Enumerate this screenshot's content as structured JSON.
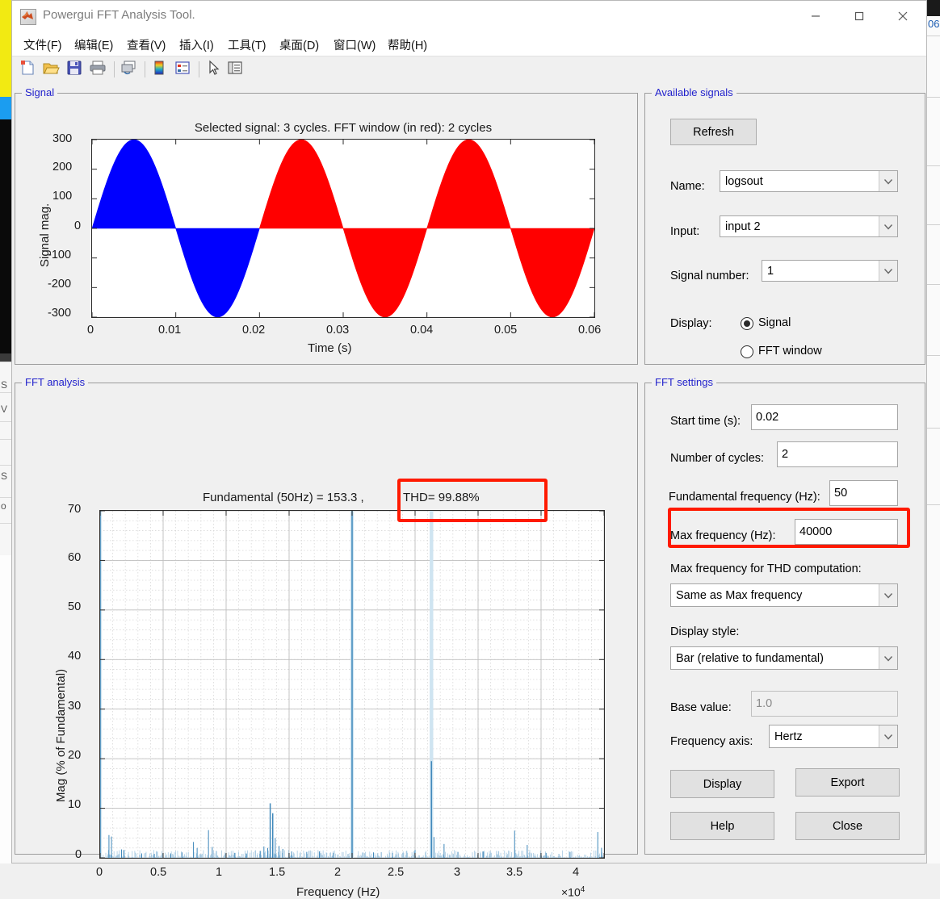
{
  "window": {
    "title": "Powergui FFT Analysis Tool.",
    "icon": "matlab-icon",
    "controls": {
      "minimize": "minimize-button",
      "maximize": "maximize-button",
      "close": "close-button"
    }
  },
  "menubar": {
    "items": [
      {
        "label": "文件(F)",
        "name": "menu-file"
      },
      {
        "label": "编辑(E)",
        "name": "menu-edit"
      },
      {
        "label": "查看(V)",
        "name": "menu-view"
      },
      {
        "label": "插入(I)",
        "name": "menu-insert"
      },
      {
        "label": "工具(T)",
        "name": "menu-tools"
      },
      {
        "label": "桌面(D)",
        "name": "menu-desktop"
      },
      {
        "label": "窗口(W)",
        "name": "menu-window"
      },
      {
        "label": "帮助(H)",
        "name": "menu-help"
      }
    ]
  },
  "toolbar": {
    "buttons": [
      "new-figure-icon",
      "open-file-icon",
      "save-figure-icon",
      "print-figure-icon",
      "link-plot-icon",
      "colorbar-icon",
      "legend-icon",
      "pointer-icon",
      "data-inspector-icon"
    ]
  },
  "signal_panel": {
    "title": "Signal"
  },
  "available_signals": {
    "title": "Available signals",
    "refresh_label": "Refresh",
    "name_label": "Name:",
    "name_value": "logsout",
    "input_label": "Input:",
    "input_value": "input 2",
    "signal_number_label": "Signal number:",
    "signal_number_value": "1",
    "display_label": "Display:",
    "radio_signal": "Signal",
    "radio_fft_window": "FFT window",
    "selected": "Signal"
  },
  "fft_analysis_panel": {
    "title": "FFT analysis"
  },
  "fft_settings": {
    "title": "FFT settings",
    "start_time_label": "Start time (s):",
    "start_time_value": "0.02",
    "num_cycles_label": "Number of cycles:",
    "num_cycles_value": "2",
    "fundamental_freq_label": "Fundamental frequency (Hz):",
    "fundamental_freq_value": "50",
    "max_freq_label": "Max frequency (Hz):",
    "max_freq_value": "40000",
    "max_freq_thd_label": "Max frequency for THD computation:",
    "max_freq_thd_value": "Same as Max frequency",
    "display_style_label": "Display style:",
    "display_style_value": "Bar (relative to fundamental)",
    "base_value_label": "Base value:",
    "base_value_value": "1.0",
    "frequency_axis_label": "Frequency axis:",
    "frequency_axis_value": "Hertz",
    "display_button": "Display",
    "export_button": "Export",
    "help_button": "Help",
    "close_button": "Close"
  },
  "highlights": {
    "accent_color": "#ff1a00",
    "thd_box": "THD= 99.88%",
    "max_freq_box": "Max frequency (Hz): 40000"
  },
  "chart_data": [
    {
      "id": "signal-plot",
      "type": "area",
      "title": "Selected signal: 3 cycles. FFT window (in red): 2 cycles",
      "xlabel": "Time (s)",
      "ylabel": "Signal mag.",
      "xlim": [
        0,
        0.06
      ],
      "ylim": [
        -300,
        300
      ],
      "xticks": [
        0,
        0.01,
        0.02,
        0.03,
        0.04,
        0.05,
        0.06
      ],
      "xtick_labels": [
        "0",
        "0.01",
        "0.02",
        "0.03",
        "0.04",
        "0.05",
        "0.06"
      ],
      "yticks": [
        -300,
        -200,
        -100,
        0,
        100,
        200,
        300
      ],
      "ytick_labels": [
        "-300",
        "-200",
        "-100",
        "0",
        "100",
        "200",
        "300"
      ],
      "grid": false,
      "series": [
        {
          "name": "signal (outside FFT window)",
          "color": "#0000ff",
          "x_range": [
            0,
            0.02
          ],
          "amplitude": 300,
          "frequency_hz": 50
        },
        {
          "name": "FFT window",
          "color": "#ff0000",
          "x_range": [
            0.02,
            0.06
          ],
          "amplitude": 300,
          "frequency_hz": 50
        }
      ],
      "description": "Sine wave, 3 cycles of 50 Hz, amplitude 300; first cycle blue, last 2 cycles red (FFT window)"
    },
    {
      "id": "fft-spectrum",
      "type": "bar",
      "title": "Fundamental (50Hz) = 153.3 , THD= 99.88%",
      "title_part1": "Fundamental (50Hz) = 153.3 ,",
      "title_part2": "THD= 99.88%",
      "xlabel": "Frequency (Hz)",
      "ylabel": "Mag (% of Fundamental)",
      "x_exponent": "×10",
      "x_exponent_power": "4",
      "xlim": [
        0,
        40000
      ],
      "ylim": [
        0,
        70
      ],
      "xticks": [
        0,
        5000,
        10000,
        15000,
        20000,
        25000,
        30000,
        35000,
        40000
      ],
      "xtick_labels": [
        "0",
        "0.5",
        "1",
        "1.5",
        "2",
        "2.5",
        "3",
        "3.5",
        "4"
      ],
      "yticks": [
        0,
        10,
        20,
        30,
        40,
        50,
        60,
        70
      ],
      "ytick_labels": [
        "0",
        "10",
        "20",
        "30",
        "40",
        "50",
        "60",
        "70"
      ],
      "grid": true,
      "bar_color": "#4a90c4",
      "peaks": [
        {
          "freq": 0,
          "mag": 72
        },
        {
          "freq": 700,
          "mag": 4.6
        },
        {
          "freq": 900,
          "mag": 4.3
        },
        {
          "freq": 1700,
          "mag": 1.7
        },
        {
          "freq": 1900,
          "mag": 1.6
        },
        {
          "freq": 3300,
          "mag": 0.9
        },
        {
          "freq": 4300,
          "mag": 0.8
        },
        {
          "freq": 5600,
          "mag": 0.9
        },
        {
          "freq": 6500,
          "mag": 1.1
        },
        {
          "freq": 7400,
          "mag": 3.2
        },
        {
          "freq": 7700,
          "mag": 2.0
        },
        {
          "freq": 8600,
          "mag": 5.6
        },
        {
          "freq": 8900,
          "mag": 2.2
        },
        {
          "freq": 10700,
          "mag": 1.0
        },
        {
          "freq": 11600,
          "mag": 0.9
        },
        {
          "freq": 12700,
          "mag": 1.4
        },
        {
          "freq": 13000,
          "mag": 2.3
        },
        {
          "freq": 13300,
          "mag": 2.0
        },
        {
          "freq": 13500,
          "mag": 11.0
        },
        {
          "freq": 13700,
          "mag": 9.0
        },
        {
          "freq": 13900,
          "mag": 4.0
        },
        {
          "freq": 14200,
          "mag": 2.4
        },
        {
          "freq": 14500,
          "mag": 1.8
        },
        {
          "freq": 15200,
          "mag": 1.3
        },
        {
          "freq": 16400,
          "mag": 1.2
        },
        {
          "freq": 17400,
          "mag": 1.3
        },
        {
          "freq": 18500,
          "mag": 1.0
        },
        {
          "freq": 20000,
          "mag": 70
        },
        {
          "freq": 21700,
          "mag": 1.1
        },
        {
          "freq": 23200,
          "mag": 1.0
        },
        {
          "freq": 25000,
          "mag": 1.6
        },
        {
          "freq": 26300,
          "mag": 19.5
        },
        {
          "freq": 26500,
          "mag": 4.2
        },
        {
          "freq": 27300,
          "mag": 2.8
        },
        {
          "freq": 28400,
          "mag": 1.2
        },
        {
          "freq": 30400,
          "mag": 1.3
        },
        {
          "freq": 32900,
          "mag": 5.5
        },
        {
          "freq": 33900,
          "mag": 2.6
        },
        {
          "freq": 35400,
          "mag": 1.0
        },
        {
          "freq": 37300,
          "mag": 1.2
        },
        {
          "freq": 39500,
          "mag": 5.2
        },
        {
          "freq": 39800,
          "mag": 2.0
        }
      ]
    }
  ]
}
